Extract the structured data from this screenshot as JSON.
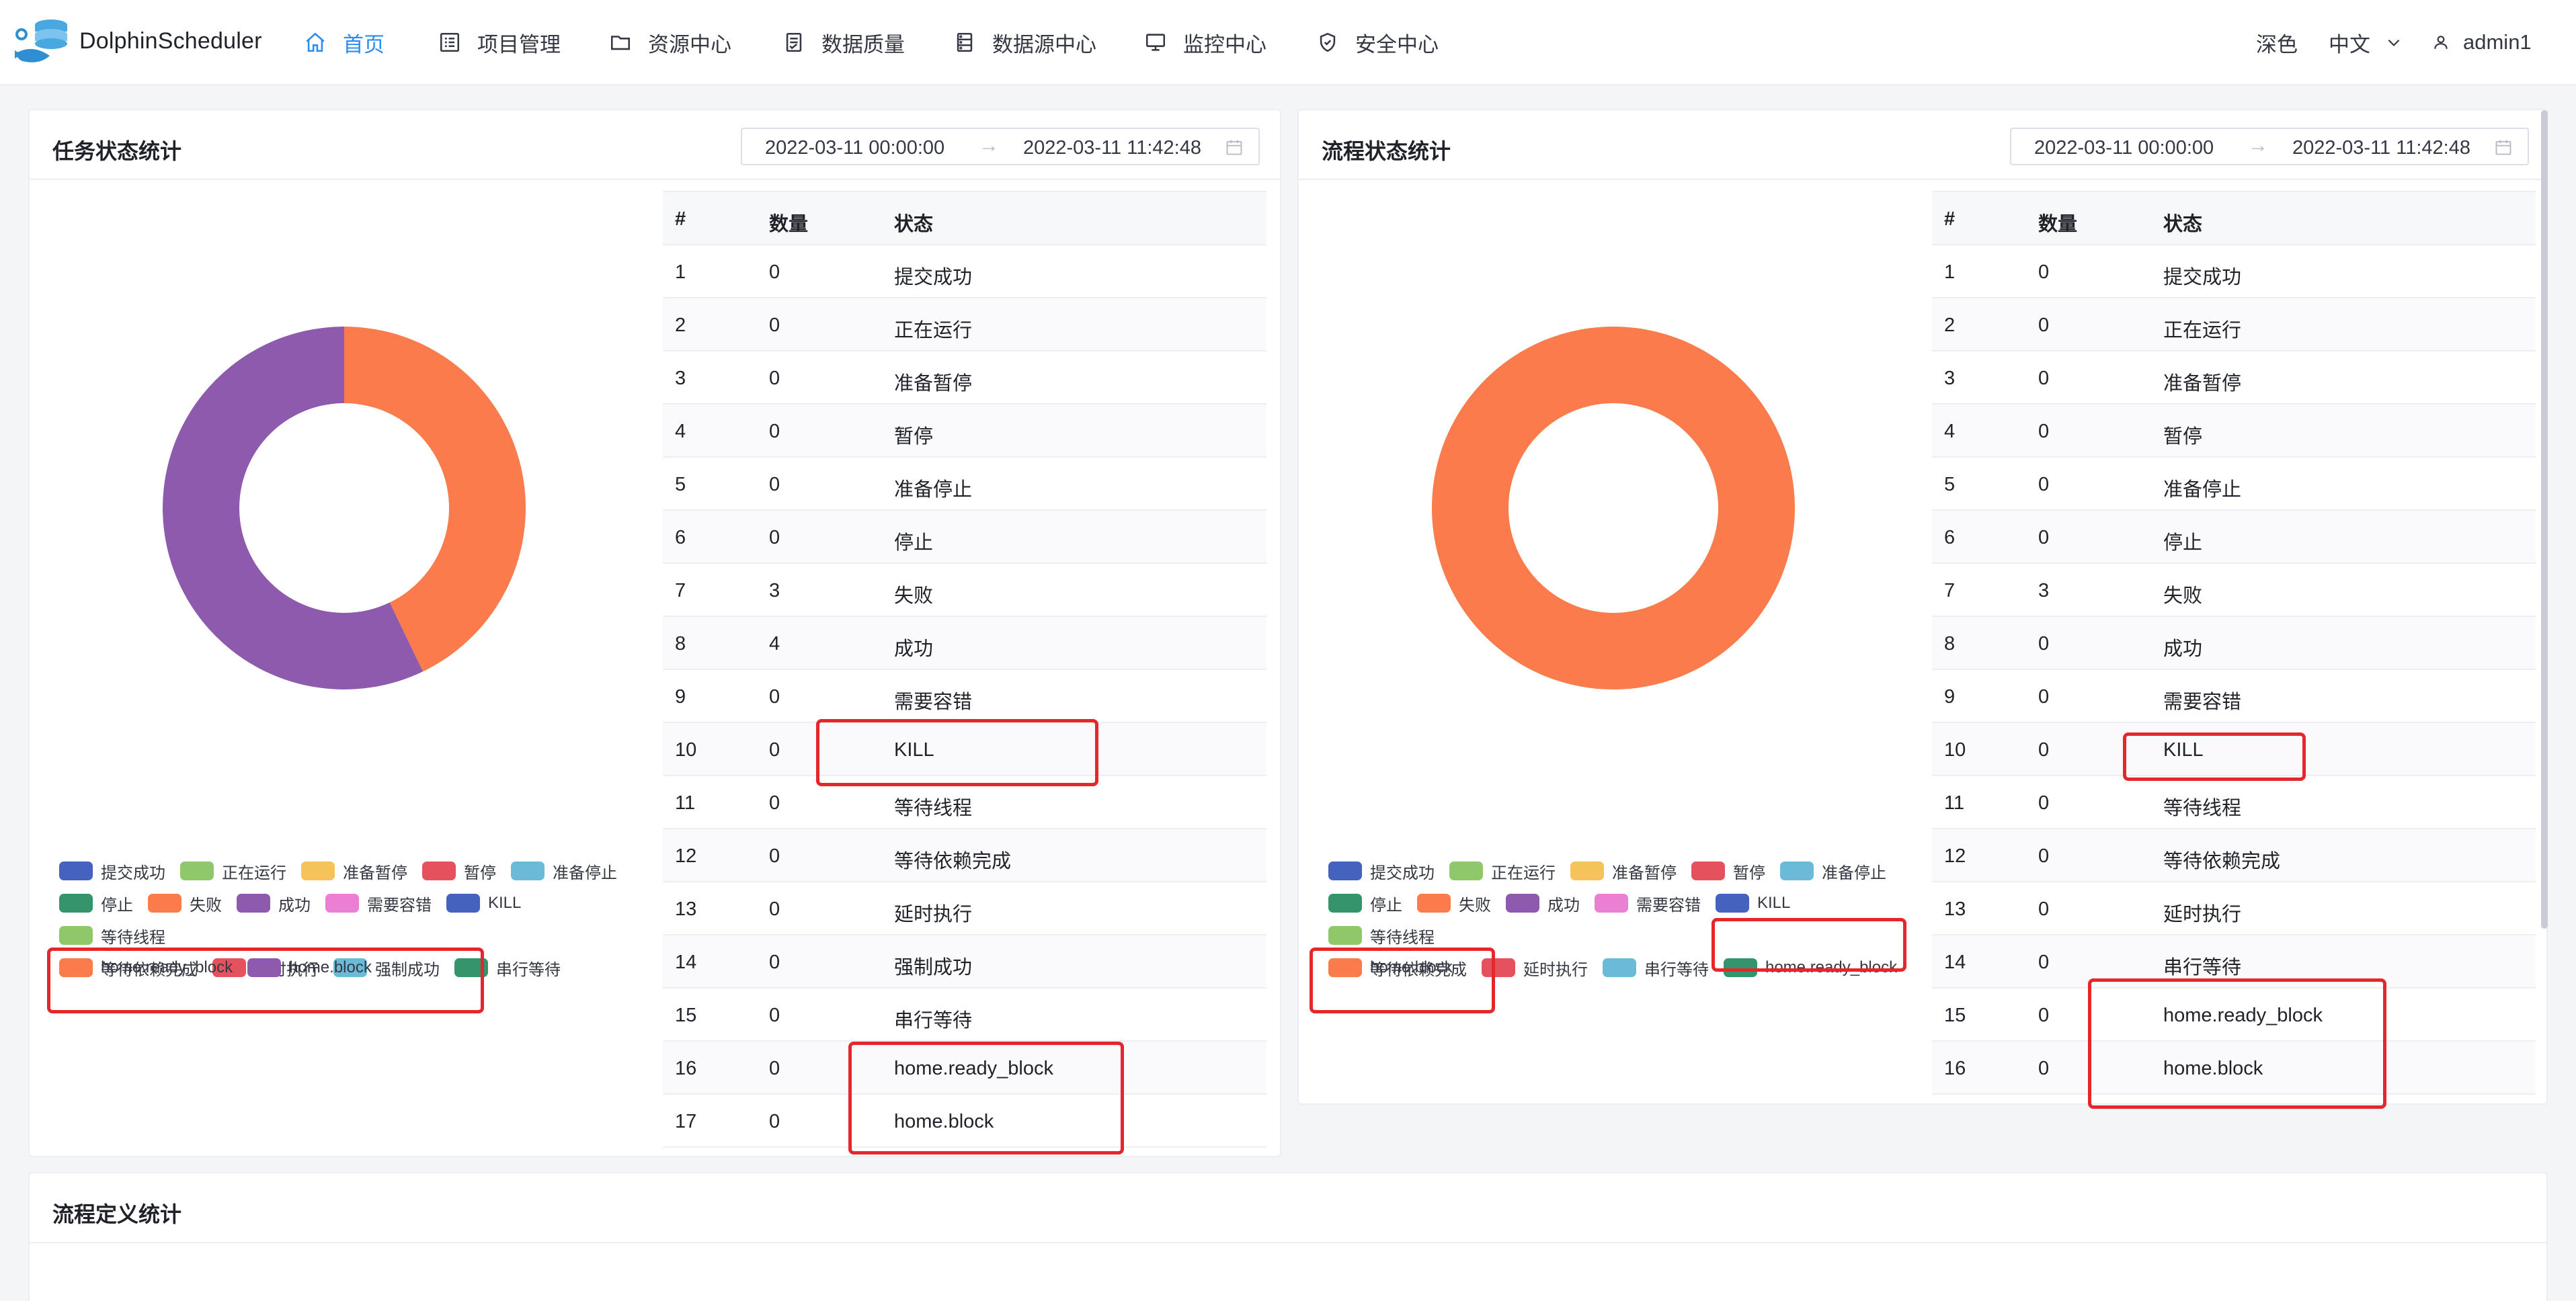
{
  "app": {
    "name": "DolphinScheduler"
  },
  "nav": {
    "items": [
      {
        "key": "home",
        "label": "首页",
        "icon": "home-icon",
        "active": true
      },
      {
        "key": "project",
        "label": "项目管理",
        "icon": "list-icon"
      },
      {
        "key": "resource",
        "label": "资源中心",
        "icon": "folder-icon"
      },
      {
        "key": "dataquality",
        "label": "数据质量",
        "icon": "document-icon"
      },
      {
        "key": "datasource",
        "label": "数据源中心",
        "icon": "database-icon"
      },
      {
        "key": "monitor",
        "label": "监控中心",
        "icon": "monitor-icon"
      },
      {
        "key": "security",
        "label": "安全中心",
        "icon": "shield-icon"
      }
    ]
  },
  "header_right": {
    "theme": "深色",
    "language": "中文",
    "user": "admin1"
  },
  "task_panel": {
    "title": "任务状态统计",
    "date_start": "2022-03-11 00:00:00",
    "date_end": "2022-03-11 11:42:48",
    "table_headers": [
      "#",
      "数量",
      "状态"
    ],
    "rows": [
      {
        "index": "1",
        "count": "0",
        "state": "提交成功"
      },
      {
        "index": "2",
        "count": "0",
        "state": "正在运行"
      },
      {
        "index": "3",
        "count": "0",
        "state": "准备暂停"
      },
      {
        "index": "4",
        "count": "0",
        "state": "暂停"
      },
      {
        "index": "5",
        "count": "0",
        "state": "准备停止"
      },
      {
        "index": "6",
        "count": "0",
        "state": "停止"
      },
      {
        "index": "7",
        "count": "3",
        "state": "失败"
      },
      {
        "index": "8",
        "count": "4",
        "state": "成功"
      },
      {
        "index": "9",
        "count": "0",
        "state": "需要容错"
      },
      {
        "index": "10",
        "count": "0",
        "state": "KILL"
      },
      {
        "index": "11",
        "count": "0",
        "state": "等待线程"
      },
      {
        "index": "12",
        "count": "0",
        "state": "等待依赖完成"
      },
      {
        "index": "13",
        "count": "0",
        "state": "延时执行"
      },
      {
        "index": "14",
        "count": "0",
        "state": "强制成功"
      },
      {
        "index": "15",
        "count": "0",
        "state": "串行等待"
      },
      {
        "index": "16",
        "count": "0",
        "state": "home.ready_block"
      },
      {
        "index": "17",
        "count": "0",
        "state": "home.block"
      }
    ],
    "legend": [
      {
        "label": "提交成功",
        "color": "#4463be"
      },
      {
        "label": "正在运行",
        "color": "#8fc86a"
      },
      {
        "label": "准备暂停",
        "color": "#f6c35a"
      },
      {
        "label": "暂停",
        "color": "#e5525e"
      },
      {
        "label": "准备停止",
        "color": "#6abad8"
      },
      {
        "label": "停止",
        "color": "#36946a"
      },
      {
        "label": "失败",
        "color": "#fa7c4c"
      },
      {
        "label": "成功",
        "color": "#8e5aad"
      },
      {
        "label": "需要容错",
        "color": "#eb7fd3"
      },
      {
        "label": "KILL",
        "color": "#4463be"
      },
      {
        "label": "等待线程",
        "color": "#8fc86a"
      },
      {
        "label": "等待依赖完成",
        "color": "#f6c35a"
      },
      {
        "label": "延时执行",
        "color": "#e5525e"
      },
      {
        "label": "强制成功",
        "color": "#6abad8"
      },
      {
        "label": "串行等待",
        "color": "#36946a"
      },
      {
        "label": "home.ready_block",
        "color": "#fa7c4c"
      },
      {
        "label": "home.block",
        "color": "#8e5aad"
      }
    ]
  },
  "process_panel": {
    "title": "流程状态统计",
    "date_start": "2022-03-11 00:00:00",
    "date_end": "2022-03-11 11:42:48",
    "table_headers": [
      "#",
      "数量",
      "状态"
    ],
    "rows": [
      {
        "index": "1",
        "count": "0",
        "state": "提交成功"
      },
      {
        "index": "2",
        "count": "0",
        "state": "正在运行"
      },
      {
        "index": "3",
        "count": "0",
        "state": "准备暂停"
      },
      {
        "index": "4",
        "count": "0",
        "state": "暂停"
      },
      {
        "index": "5",
        "count": "0",
        "state": "准备停止"
      },
      {
        "index": "6",
        "count": "0",
        "state": "停止"
      },
      {
        "index": "7",
        "count": "3",
        "state": "失败"
      },
      {
        "index": "8",
        "count": "0",
        "state": "成功"
      },
      {
        "index": "9",
        "count": "0",
        "state": "需要容错"
      },
      {
        "index": "10",
        "count": "0",
        "state": "KILL"
      },
      {
        "index": "11",
        "count": "0",
        "state": "等待线程"
      },
      {
        "index": "12",
        "count": "0",
        "state": "等待依赖完成"
      },
      {
        "index": "13",
        "count": "0",
        "state": "延时执行"
      },
      {
        "index": "14",
        "count": "0",
        "state": "串行等待"
      },
      {
        "index": "15",
        "count": "0",
        "state": "home.ready_block"
      },
      {
        "index": "16",
        "count": "0",
        "state": "home.block"
      }
    ],
    "legend": [
      {
        "label": "提交成功",
        "color": "#4463be"
      },
      {
        "label": "正在运行",
        "color": "#8fc86a"
      },
      {
        "label": "准备暂停",
        "color": "#f6c35a"
      },
      {
        "label": "暂停",
        "color": "#e5525e"
      },
      {
        "label": "准备停止",
        "color": "#6abad8"
      },
      {
        "label": "停止",
        "color": "#36946a"
      },
      {
        "label": "失败",
        "color": "#fa7c4c"
      },
      {
        "label": "成功",
        "color": "#8e5aad"
      },
      {
        "label": "需要容错",
        "color": "#eb7fd3"
      },
      {
        "label": "KILL",
        "color": "#4463be"
      },
      {
        "label": "等待线程",
        "color": "#8fc86a"
      },
      {
        "label": "等待依赖完成",
        "color": "#f6c35a"
      },
      {
        "label": "延时执行",
        "color": "#e5525e"
      },
      {
        "label": "串行等待",
        "color": "#6abad8"
      },
      {
        "label": "home.ready_block",
        "color": "#36946a"
      },
      {
        "label": "home.block",
        "color": "#fa7c4c"
      }
    ]
  },
  "definition_panel": {
    "title": "流程定义统计"
  },
  "chart_data": [
    {
      "type": "pie",
      "donut": true,
      "labels": [
        "失败",
        "成功"
      ],
      "values": [
        3,
        4
      ],
      "colors": [
        "#fa7c4c",
        "#8e5aad"
      ]
    },
    {
      "type": "pie",
      "donut": true,
      "labels": [
        "失败"
      ],
      "values": [
        3
      ],
      "colors": [
        "#fa7c4c"
      ]
    }
  ]
}
